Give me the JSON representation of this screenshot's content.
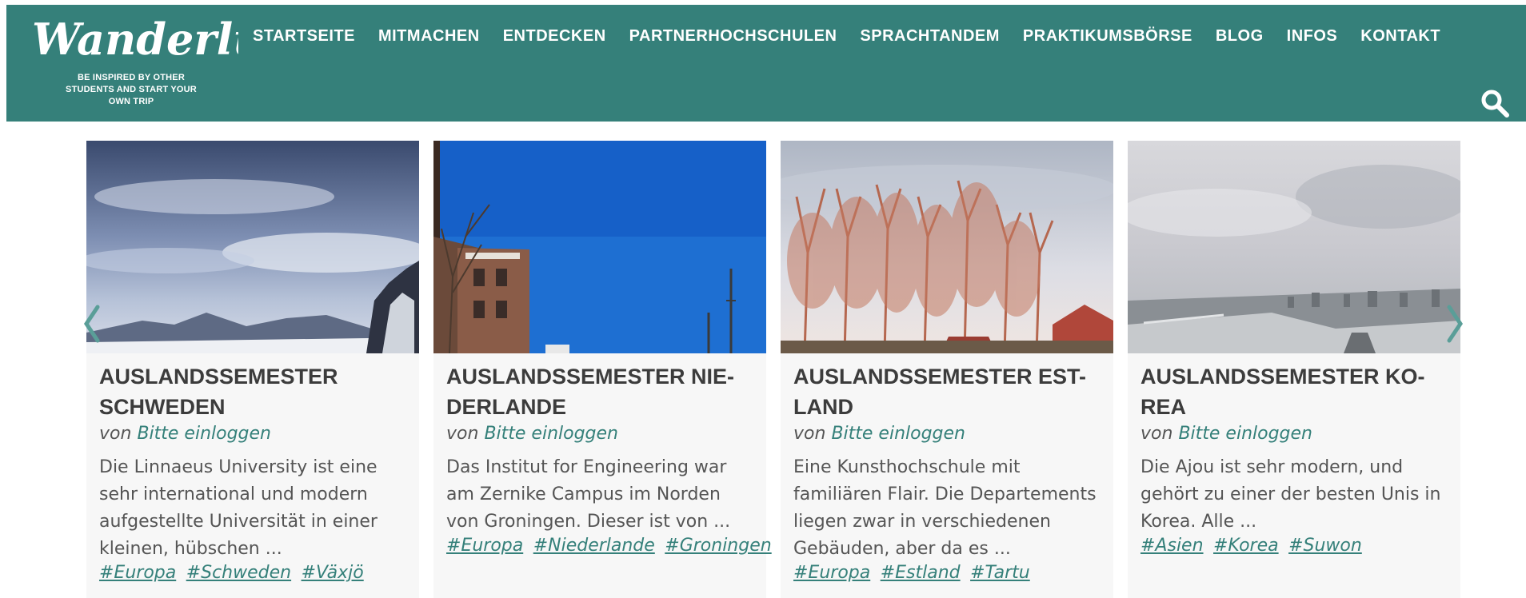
{
  "header": {
    "logo_text": "Wanderlust",
    "tagline": [
      "BE INSPIRED BY OTHER",
      "STUDENTS AND START YOUR",
      "OWN TRIP"
    ],
    "bg_color": "#35807a"
  },
  "nav": {
    "items": [
      "STARTSEITE",
      "MITMACHEN",
      "ENTDECKEN",
      "PARTNERHOCHSCHULEN",
      "SPRACHTANDEM",
      "PRAKTIKUMSBÖRSE",
      "BLOG",
      "INFOS",
      "KONTAKT"
    ]
  },
  "search": {
    "icon": "search-icon"
  },
  "carousel": {
    "prev_icon": "chevron-left-icon",
    "next_icon": "chevron-right-icon",
    "cards": [
      {
        "image": "sweden-mountains-sky",
        "title": "AUSLANDSSEMESTER SCHWEDEN",
        "title_lines": [
          "AUSLANDSSEMESTER",
          "SCHWEDEN"
        ],
        "author_prefix": "von",
        "author": "Bitte einloggen",
        "excerpt": "Die Linnaeus University ist eine sehr international und modern aufgestellte Universität in einer kleinen, hübschen ...",
        "tags": [
          "#Europa",
          "#Schweden",
          "#Växjö"
        ]
      },
      {
        "image": "netherlands-building-blue-sky",
        "title": "AUSLANDSSEMESTER NIEDERLANDE",
        "title_lines": [
          "AUSLANDSSEMESTER NIE-",
          "DERLANDE"
        ],
        "author_prefix": "von",
        "author": "Bitte einloggen",
        "excerpt": "Das Institut for Engineering war am Zernike Campus im Norden von Groningen. Dieser ist von ...",
        "tags": [
          "#Europa",
          "#Niederlande",
          "#Groningen"
        ]
      },
      {
        "image": "estonia-trees-roofs",
        "title": "AUSLANDSSEMESTER ESTLAND",
        "title_lines": [
          "AUSLANDSSEMESTER EST-",
          "LAND"
        ],
        "author_prefix": "von",
        "author": "Bitte einloggen",
        "excerpt": "Eine Kunsthochschule mit familiären Flair. Die Departements liegen zwar in verschiedenen Gebäuden, aber da es ...",
        "tags": [
          "#Europa",
          "#Estland",
          "#Tartu"
        ]
      },
      {
        "image": "korea-city-haze",
        "title": "AUSLANDSSEMESTER KOREA",
        "title_lines": [
          "AUSLANDSSEMESTER KO-",
          "REA"
        ],
        "author_prefix": "von",
        "author": "Bitte einloggen",
        "excerpt": "Die Ajou ist sehr modern, und gehört zu einer der besten Unis in Korea. Alle ...",
        "tags": [
          "#Asien",
          "#Korea",
          "#Suwon"
        ]
      }
    ]
  }
}
